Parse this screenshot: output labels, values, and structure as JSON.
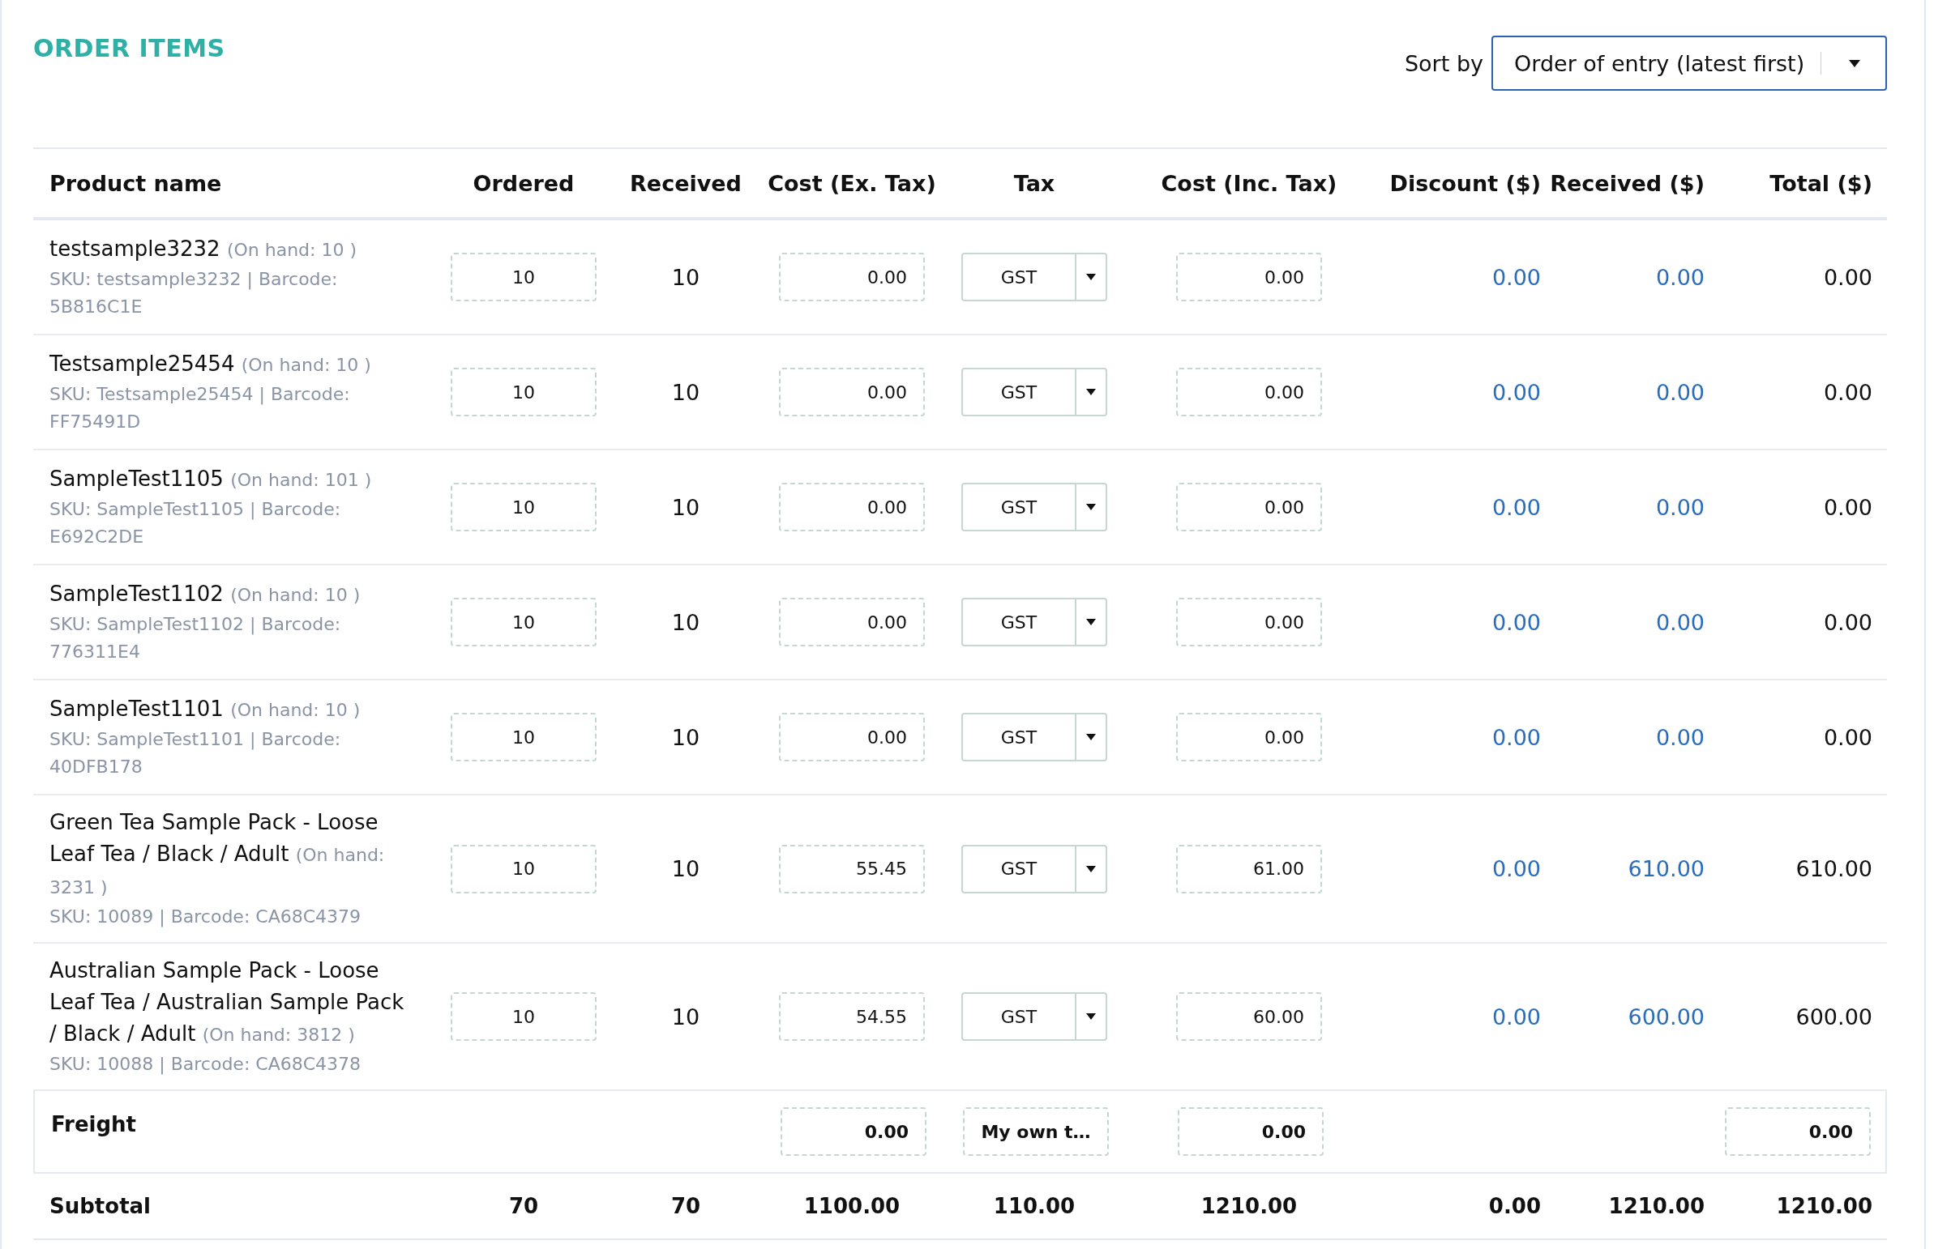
{
  "title": "ORDER ITEMS",
  "sort": {
    "label": "Sort by",
    "value": "Order of entry (latest first)"
  },
  "columns": [
    "Product name",
    "Ordered",
    "Received",
    "Cost (Ex. Tax)",
    "Tax",
    "Cost (Inc. Tax)",
    "Discount ($)",
    "Received ($)",
    "Total ($)"
  ],
  "rows": [
    {
      "name": "testsample3232",
      "on_hand": "(On hand: 10 )",
      "sku": "SKU: testsample3232 | Barcode: 5B816C1E",
      "ordered": "10",
      "received": "10",
      "cost_ex": "0.00",
      "tax": "GST",
      "cost_inc": "0.00",
      "discount": "0.00",
      "received_amount": "0.00",
      "total": "0.00"
    },
    {
      "name": "Testsample25454",
      "on_hand": "(On hand: 10 )",
      "sku": "SKU: Testsample25454 | Barcode: FF75491D",
      "ordered": "10",
      "received": "10",
      "cost_ex": "0.00",
      "tax": "GST",
      "cost_inc": "0.00",
      "discount": "0.00",
      "received_amount": "0.00",
      "total": "0.00"
    },
    {
      "name": "SampleTest1105",
      "on_hand": "(On hand: 101 )",
      "sku": "SKU: SampleTest1105 | Barcode: E692C2DE",
      "ordered": "10",
      "received": "10",
      "cost_ex": "0.00",
      "tax": "GST",
      "cost_inc": "0.00",
      "discount": "0.00",
      "received_amount": "0.00",
      "total": "0.00"
    },
    {
      "name": "SampleTest1102",
      "on_hand": "(On hand: 10 )",
      "sku": "SKU: SampleTest1102 | Barcode: 776311E4",
      "ordered": "10",
      "received": "10",
      "cost_ex": "0.00",
      "tax": "GST",
      "cost_inc": "0.00",
      "discount": "0.00",
      "received_amount": "0.00",
      "total": "0.00"
    },
    {
      "name": "SampleTest1101",
      "on_hand": "(On hand: 10 )",
      "sku": "SKU: SampleTest1101 | Barcode: 40DFB178",
      "ordered": "10",
      "received": "10",
      "cost_ex": "0.00",
      "tax": "GST",
      "cost_inc": "0.00",
      "discount": "0.00",
      "received_amount": "0.00",
      "total": "0.00"
    },
    {
      "name": "Green Tea Sample Pack - Loose Leaf Tea / Black / Adult",
      "on_hand": "(On hand: 3231 )",
      "sku": "SKU: 10089 | Barcode: CA68C4379",
      "ordered": "10",
      "received": "10",
      "cost_ex": "55.45",
      "tax": "GST",
      "cost_inc": "61.00",
      "discount": "0.00",
      "received_amount": "610.00",
      "total": "610.00"
    },
    {
      "name": "Australian Sample Pack - Loose Leaf Tea / Australian Sample Pack / Black / Adult",
      "on_hand": "(On hand: 3812 )",
      "sku": "SKU: 10088 | Barcode: CA68C4378",
      "ordered": "10",
      "received": "10",
      "cost_ex": "54.55",
      "tax": "GST",
      "cost_inc": "60.00",
      "discount": "0.00",
      "received_amount": "600.00",
      "total": "600.00"
    }
  ],
  "freight": {
    "label": "Freight",
    "cost_ex": "0.00",
    "tax": "My own t…",
    "cost_inc": "0.00",
    "total": "0.00"
  },
  "subtotal": {
    "label": "Subtotal",
    "ordered": "70",
    "received": "70",
    "cost_ex": "1100.00",
    "tax": "110.00",
    "cost_inc": "1210.00",
    "discount": "0.00",
    "received_amount": "1210.00",
    "total": "1210.00"
  }
}
